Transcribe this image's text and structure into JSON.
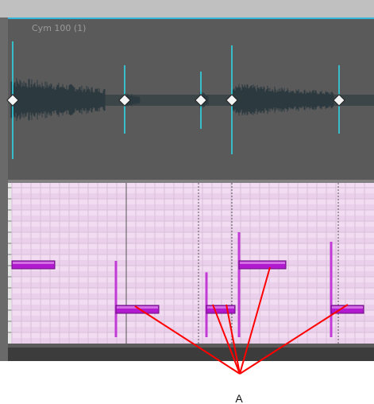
{
  "clip": {
    "title": "Cym 100 (1)"
  },
  "audio_track": {
    "transients": [
      {
        "id": "t1",
        "marker": true
      },
      {
        "id": "t2",
        "marker": true
      },
      {
        "id": "t3",
        "marker": true
      },
      {
        "id": "t4",
        "marker": true
      },
      {
        "id": "t5",
        "marker": true
      }
    ]
  },
  "piano_roll": {
    "notes": [
      {
        "id": "n1",
        "pitch_row": 3,
        "velocity": 0.35
      },
      {
        "id": "n2",
        "pitch_row": 5,
        "velocity": 0.4
      },
      {
        "id": "n3",
        "pitch_row": 5,
        "velocity": 0.34
      },
      {
        "id": "n4",
        "pitch_row": 3,
        "velocity": 0.55
      },
      {
        "id": "n5",
        "pitch_row": 5,
        "velocity": 0.5
      }
    ]
  },
  "callout": {
    "label": "A"
  },
  "colors": {
    "background": "#ffffff",
    "top_strip": "#b8b8b8",
    "audio_bg": "#5a5a5a",
    "audio_border": "#33b4d8",
    "waveform": "#2c3a40",
    "transient": "#2fd6e6",
    "roll_bg": "#f1dcf1",
    "roll_grid": "#d9bfd9",
    "note": "#b21ad0",
    "note_edge": "#6b0f7e",
    "callout_line": "#ff0000",
    "bottom_bar": "#3c3c3c"
  }
}
